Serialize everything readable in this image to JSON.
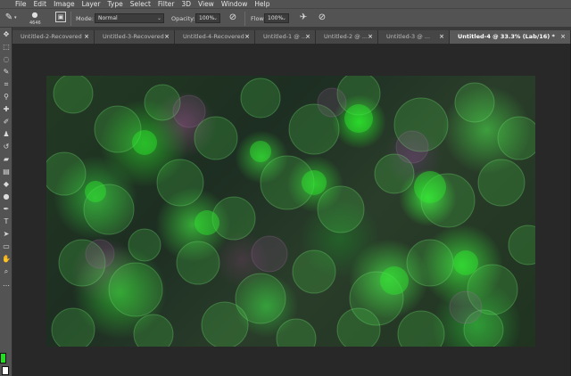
{
  "menu": [
    "File",
    "Edit",
    "Image",
    "Layer",
    "Type",
    "Select",
    "Filter",
    "3D",
    "View",
    "Window",
    "Help"
  ],
  "options": {
    "brush_size": "4646",
    "mode_label": "Mode:",
    "mode_value": "Normal",
    "opacity_label": "Opacity:",
    "opacity_value": "100%",
    "flow_label": "Flow:",
    "flow_value": "100%"
  },
  "tabs": [
    {
      "label": "Untitled-2-Recovered",
      "close": "×"
    },
    {
      "label": "Untitled-3-Recovered",
      "close": "×"
    },
    {
      "label": "Untitled-4-Recovered",
      "close": "×"
    },
    {
      "label": "Untitled-1 @ ...",
      "close": "×"
    },
    {
      "label": "Untitled-2 @ ...",
      "close": "×"
    },
    {
      "label": "Untitled-3 @ ...",
      "close": "×"
    },
    {
      "label": "Untitled-4 @ 33.3% (Lab/16) *",
      "close": "×"
    }
  ],
  "active_tab_index": 6,
  "colors": {
    "foreground": "#22dd22",
    "background": "#ffffff",
    "ui_panel": "#535353",
    "workspace": "#282828"
  },
  "tools": [
    "move-icon",
    "marquee-icon",
    "lasso-icon",
    "quick-select-icon",
    "crop-icon",
    "eyedropper-icon",
    "healing-icon",
    "brush-icon",
    "stamp-icon",
    "history-brush-icon",
    "eraser-icon",
    "gradient-icon",
    "blur-icon",
    "dodge-icon",
    "pen-icon",
    "type-icon",
    "path-select-icon",
    "shape-icon",
    "hand-icon",
    "zoom-icon",
    "more-icon"
  ]
}
